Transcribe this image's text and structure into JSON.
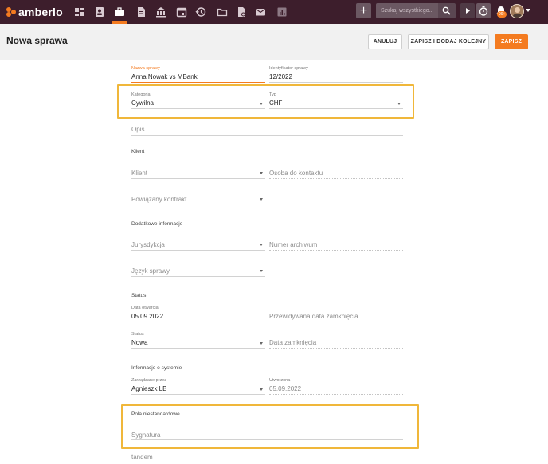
{
  "app": {
    "logo_text": "amberlo"
  },
  "topbar": {
    "nav_icons": [
      "dashboard-icon",
      "contacts-icon",
      "matters-icon",
      "documents-icon",
      "bank-icon",
      "calendar-icon",
      "history-icon",
      "folder-icon",
      "invoices-icon",
      "mail-icon",
      "reports-icon"
    ],
    "search_placeholder": "Szukaj wszystkiego...",
    "plus_label": "+",
    "notification_badge": "99+"
  },
  "header": {
    "title": "Nowa sprawa",
    "cancel_label": "ANULUJ",
    "save_add_label": "ZAPISZ I DODAJ KOLEJNY",
    "save_label": "ZAPISZ"
  },
  "form": {
    "case_name_label": "Nazwa sprawy",
    "case_name_value": "Anna Nowak vs MBank",
    "case_id_label": "Identyfikator sprawy",
    "case_id_value": "12/2022",
    "category_label": "Kategoria",
    "category_value": "Cywilna",
    "type_label": "Typ",
    "type_value": "CHF",
    "description_placeholder": "Opis",
    "client_section": "Klient",
    "client_placeholder": "Klient",
    "contact_placeholder": "Osoba do kontaktu",
    "related_contract_placeholder": "Powiązany kontrakt",
    "extra_section": "Dodatkowe informacje",
    "jurisdiction_placeholder": "Jurysdykcja",
    "archive_placeholder": "Numer archiwum",
    "language_placeholder": "Język sprawy",
    "status_section": "Status",
    "opened_label": "Data otwarcia",
    "opened_value": "05.09.2022",
    "expected_close_placeholder": "Przewidywana data zamknięcia",
    "status_label": "Status",
    "status_value": "Nowa",
    "close_date_placeholder": "Data zamknięcia",
    "system_section": "Informacje o systemie",
    "managed_by_label": "Zarządzane przez",
    "managed_by_value": "Agnieszk LB",
    "created_label": "Utworzona",
    "created_value": "05.09.2022",
    "custom_section": "Pola niestandardowe",
    "signature_placeholder": "Sygnatura",
    "tandem_placeholder": "tandem"
  },
  "colors": {
    "topbar": "#3d1e2c",
    "accent": "#f47b20",
    "highlight": "#f0b73a"
  }
}
